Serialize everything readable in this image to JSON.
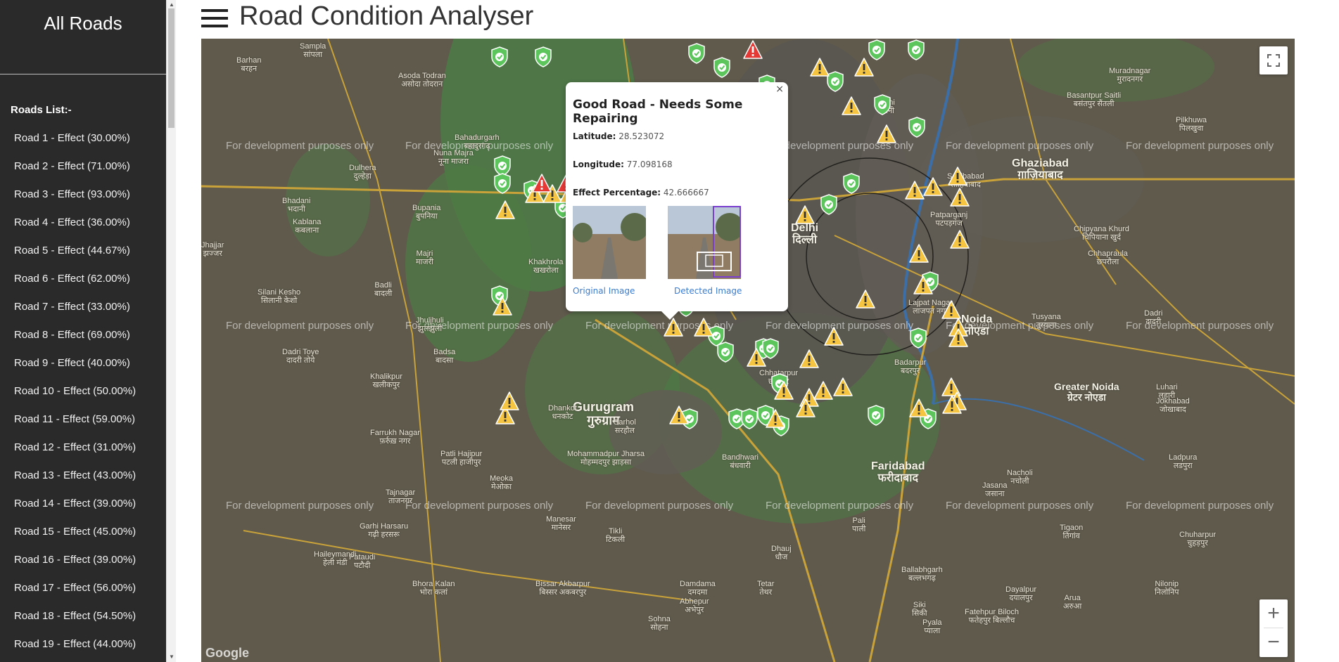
{
  "sidebar": {
    "title": "All Roads",
    "list_heading": "Roads List:-",
    "roads": [
      "Road 1 - Effect (30.00%)",
      "Road 2 - Effect (71.00%)",
      "Road 3 - Effect (93.00%)",
      "Road 4 - Effect (36.00%)",
      "Road 5 - Effect (44.67%)",
      "Road 6 - Effect (62.00%)",
      "Road 7 - Effect (33.00%)",
      "Road 8 - Effect (69.00%)",
      "Road 9 - Effect (40.00%)",
      "Road 10 - Effect (50.00%)",
      "Road 11 - Effect (59.00%)",
      "Road 12 - Effect (31.00%)",
      "Road 13 - Effect (43.00%)",
      "Road 14 - Effect (39.00%)",
      "Road 15 - Effect (45.00%)",
      "Road 16 - Effect (39.00%)",
      "Road 17 - Effect (56.00%)",
      "Road 18 - Effect (54.50%)",
      "Road 19 - Effect (44.00%)"
    ]
  },
  "header": {
    "title": "Road Condition Analyser",
    "menu_icon": "hamburger-icon"
  },
  "map": {
    "watermark": "For development purposes only",
    "cities": [
      {
        "name": "Gurugram",
        "name_hi": "गुरुग्राम"
      },
      {
        "name": "Faridabad",
        "name_hi": "फरीदाबाद"
      },
      {
        "name": "Ghaziabad",
        "name_hi": "ग़ाज़ियाबाद"
      },
      {
        "name": "Noida",
        "name_hi": "नोएडा"
      },
      {
        "name": "Delhi",
        "name_hi": "दिल्ली"
      },
      {
        "name": "Greater Noida",
        "name_hi": "ग्रेटर नोएडा"
      }
    ],
    "towns": [
      {
        "name": "Sampla",
        "name_hi": "सांपला"
      },
      {
        "name": "Barhan",
        "name_hi": "बरहन"
      },
      {
        "name": "Asoda Todran",
        "name_hi": "असोदा तोदरान"
      },
      {
        "name": "Bahadurgarh",
        "name_hi": "बहादुरगढ़"
      },
      {
        "name": "Nuna Majra",
        "name_hi": "नूना माजरा"
      },
      {
        "name": "Dulhera",
        "name_hi": "दुल्हेड़ा"
      },
      {
        "name": "Bhadani",
        "name_hi": "भदानी"
      },
      {
        "name": "Bupania",
        "name_hi": "बुपनिया"
      },
      {
        "name": "Kablana",
        "name_hi": "कबलाना"
      },
      {
        "name": "Jhajjar",
        "name_hi": "झज्जर"
      },
      {
        "name": "Majri",
        "name_hi": "माजरी"
      },
      {
        "name": "Khakhrola",
        "name_hi": "खखरोला"
      },
      {
        "name": "Badli",
        "name_hi": "बादली"
      },
      {
        "name": "Silani Kesho",
        "name_hi": "सिलानी केशो"
      },
      {
        "name": "Jhuljhuli",
        "name_hi": "झुलझुली"
      },
      {
        "name": "Badsa",
        "name_hi": "बादसा"
      },
      {
        "name": "Dadri Toye",
        "name_hi": "दादरी तोये"
      },
      {
        "name": "Khalikpur",
        "name_hi": "खलीकपुर"
      },
      {
        "name": "Farrukh Nagar",
        "name_hi": "फ़र्रुख़ नगर"
      },
      {
        "name": "Patli Hajipur",
        "name_hi": "पटली हाजीपुर"
      },
      {
        "name": "Mohammadpur Jharsa",
        "name_hi": "मोहम्मदपुर झाड़सा"
      },
      {
        "name": "Meoka",
        "name_hi": "मेओका"
      },
      {
        "name": "Manesar",
        "name_hi": "मानेसर"
      },
      {
        "name": "Tikli",
        "name_hi": "टिकली"
      },
      {
        "name": "Garhi Harsaru",
        "name_hi": "गढ़ी हरसरू"
      },
      {
        "name": "Pataudi",
        "name_hi": "पटौदी"
      },
      {
        "name": "Haileymandi",
        "name_hi": "हेली मंडी"
      },
      {
        "name": "Bhora Kalan",
        "name_hi": "भोरा कलां"
      },
      {
        "name": "Bissar Akbarpur",
        "name_hi": "बिस्सर अकबरपुर"
      },
      {
        "name": "Damdama",
        "name_hi": "दमदमा"
      },
      {
        "name": "Abhepur",
        "name_hi": "अभेपुर"
      },
      {
        "name": "Sohna",
        "name_hi": "सोहना"
      },
      {
        "name": "Bandhwari",
        "name_hi": "बंधवारी"
      },
      {
        "name": "Pali",
        "name_hi": "पाली"
      },
      {
        "name": "Dhauj",
        "name_hi": "धौज"
      },
      {
        "name": "Ballabhgarh",
        "name_hi": "बल्लभगढ़"
      },
      {
        "name": "Tigaon",
        "name_hi": "तिगांव"
      },
      {
        "name": "Nacholi",
        "name_hi": "नचोली"
      },
      {
        "name": "Jasana",
        "name_hi": "जसाना"
      },
      {
        "name": "Dadri",
        "name_hi": "दादरी"
      },
      {
        "name": "Tusyana",
        "name_hi": "तुस्याना"
      },
      {
        "name": "Luhari",
        "name_hi": "लुहारी"
      },
      {
        "name": "Jokhabad",
        "name_hi": "जोखाबाद"
      },
      {
        "name": "Ladpura",
        "name_hi": "लडपुरा"
      },
      {
        "name": "Chhapraula",
        "name_hi": "छपरौला"
      },
      {
        "name": "Chipyana Khurd",
        "name_hi": "चिपियाना खुर्द"
      },
      {
        "name": "Muradnagar",
        "name_hi": "मुरादनगर"
      },
      {
        "name": "Pilkhuwa",
        "name_hi": "पिलखुवा"
      },
      {
        "name": "Basantpur Saitli",
        "name_hi": "बसंतपुर सैंतली"
      },
      {
        "name": "Loni",
        "name_hi": "लोनी"
      },
      {
        "name": "Sahibabad",
        "name_hi": "साहिबाबाद"
      },
      {
        "name": "Patparganj",
        "name_hi": "पटपड़गंज"
      },
      {
        "name": "Lajpat Nagar",
        "name_hi": "लाजपत नगर"
      },
      {
        "name": "Chhatarpur",
        "name_hi": "छतरपुर"
      },
      {
        "name": "Badarpur",
        "name_hi": "बदरपुर"
      },
      {
        "name": "Sarhol",
        "name_hi": "सरहौल"
      },
      {
        "name": "Dhankot",
        "name_hi": "धनकोट"
      },
      {
        "name": "Tajnagar",
        "name_hi": "ताजनगर"
      },
      {
        "name": "Tetar",
        "name_hi": "तेथर"
      },
      {
        "name": "Siki",
        "name_hi": "सिकी"
      },
      {
        "name": "Pyala",
        "name_hi": "प्याला"
      },
      {
        "name": "Fatehpur Biloch",
        "name_hi": "फतेहपुर बिल्लौच"
      },
      {
        "name": "Dayalpur",
        "name_hi": "दयालपुर"
      },
      {
        "name": "Arua",
        "name_hi": "अरुआ"
      },
      {
        "name": "Nilonip",
        "name_hi": "निलोनिप"
      },
      {
        "name": "Chuharpur",
        "name_hi": "चुहड़पुर"
      }
    ],
    "fullscreen_icon": "fullscreen-icon",
    "zoom_in": "+",
    "zoom_out": "−",
    "logo": "Google"
  },
  "popup": {
    "title": "Good Road - Needs Some Repairing",
    "latitude_label": "Latitude:",
    "latitude": "28.523072",
    "longitude_label": "Longitude:",
    "longitude": "77.098168",
    "effect_label": "Effect Percentage:",
    "effect": "42.666667",
    "original_link": "Original Image",
    "detected_link": "Detected Image",
    "close": "×"
  },
  "colors": {
    "sidebar_bg": "#2a2a2a",
    "map_bg": "#5f5a4c",
    "good_marker": "#5cc55c",
    "warning_marker": "#f5c542",
    "danger_marker": "#e53935",
    "link": "#3a7dd0"
  }
}
